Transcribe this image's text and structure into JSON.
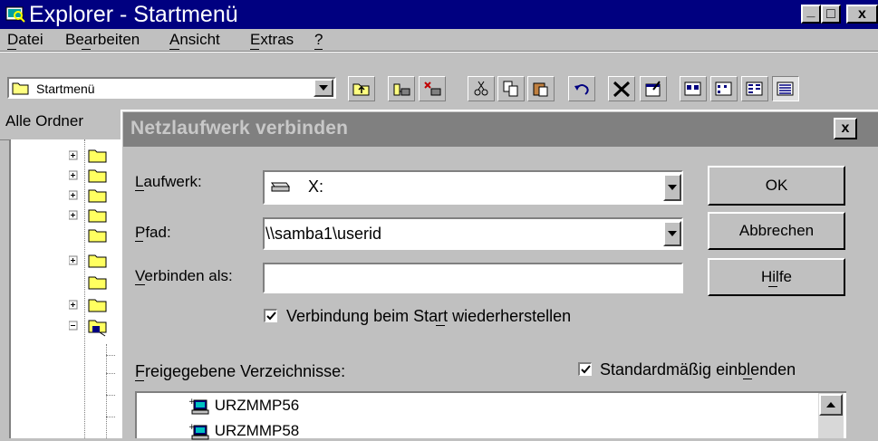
{
  "explorer": {
    "title": "Explorer - Startmenü",
    "window_buttons": {
      "minimize": "_",
      "maximize": "□",
      "close": "x"
    },
    "menu": [
      {
        "label": "Datei"
      },
      {
        "label": "Bearbeiten"
      },
      {
        "label": "Ansicht"
      },
      {
        "label": "Extras"
      },
      {
        "label": "?"
      }
    ],
    "address_value": "Startmenü",
    "folder_pane_header": "Alle Ordner"
  },
  "dialog": {
    "title": "Netzlaufwerk verbinden",
    "close_label": "x",
    "laufwerk_label": "Laufwerk:",
    "laufwerk_value": "X:",
    "pfad_label": "Pfad:",
    "pfad_value": "\\\\samba1\\userid",
    "verbinden_label": "Verbinden als:",
    "verbinden_value": "",
    "reconnect_label": "Verbindung beim Start wiederherstellen",
    "reconnect_checked": true,
    "ok_label": "OK",
    "cancel_label": "Abbrechen",
    "help_label": "Hilfe",
    "shares_label": "Freigegebene Verzeichnisse:",
    "default_expand_label": "Standardmäßig einblenden",
    "default_expand_checked": true,
    "shares": [
      {
        "name": "URZMMP56"
      },
      {
        "name": "URZMMP58"
      }
    ]
  },
  "colors": {
    "titlebar_active": "#000080",
    "titlebar_inactive": "#808080",
    "face": "#c0c0c0"
  }
}
